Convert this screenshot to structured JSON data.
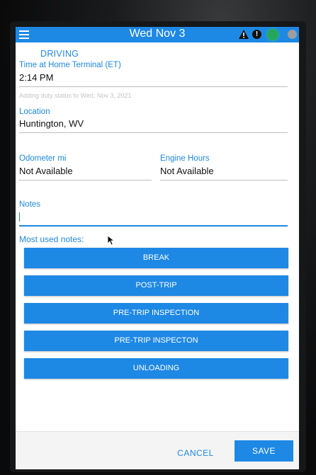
{
  "header": {
    "title": "Wed Nov 3",
    "menu_icon": "hamburger-menu-icon",
    "warning_icon": "warning-triangle-icon",
    "alert_icon": "exclamation-circle-icon",
    "alert_glyph": "!",
    "status_icon": "green-status-dot-icon",
    "extra_icon": "gray-status-dot-icon",
    "bar_color": "#1e88e5"
  },
  "form": {
    "duty_status": "DRIVING",
    "time_label": "Time at Home Terminal (ET)",
    "time_value": "2:14 PM",
    "hint": "Adding duty status to Wed, Nov 3, 2021",
    "location_label": "Location",
    "location_value": "Huntington, WV",
    "odometer_label": "Odometer mi",
    "odometer_value": "Not Available",
    "engine_label": "Engine Hours",
    "engine_value": "Not Available",
    "notes_label": "Notes",
    "notes_value": ""
  },
  "most_used": {
    "label": "Most used notes:",
    "buttons": [
      "BREAK",
      "POST-TRIP",
      "PRE-TRIP INSPECTION",
      "PRE-TRIP INSPECTON",
      "UNLOADING"
    ]
  },
  "footer": {
    "cancel_label": "CANCEL",
    "save_label": "SAVE"
  },
  "colors": {
    "accent": "#1e88e5",
    "status_green": "#26a65b"
  }
}
